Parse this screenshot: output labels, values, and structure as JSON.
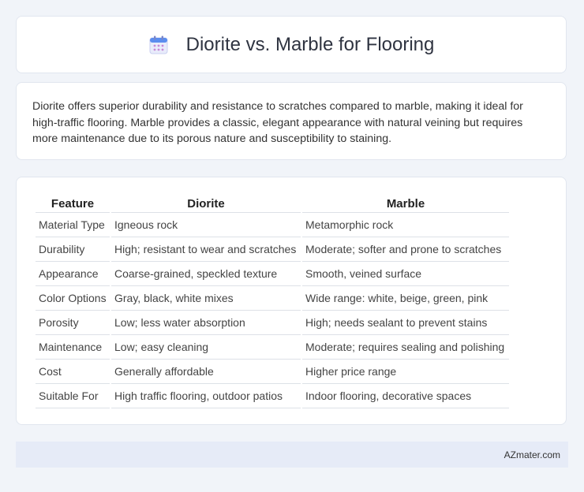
{
  "header": {
    "title": "Diorite vs. Marble for Flooring",
    "icon": "calendar-icon"
  },
  "description": "Diorite offers superior durability and resistance to scratches compared to marble, making it ideal for high-traffic flooring. Marble provides a classic, elegant appearance with natural veining but requires more maintenance due to its porous nature and susceptibility to staining.",
  "table": {
    "headers": [
      "Feature",
      "Diorite",
      "Marble"
    ],
    "rows": [
      [
        "Material Type",
        "Igneous rock",
        "Metamorphic rock"
      ],
      [
        "Durability",
        "High; resistant to wear and scratches",
        "Moderate; softer and prone to scratches"
      ],
      [
        "Appearance",
        "Coarse-grained, speckled texture",
        "Smooth, veined surface"
      ],
      [
        "Color Options",
        "Gray, black, white mixes",
        "Wide range: white, beige, green, pink"
      ],
      [
        "Porosity",
        "Low; less water absorption",
        "High; needs sealant to prevent stains"
      ],
      [
        "Maintenance",
        "Low; easy cleaning",
        "Moderate; requires sealing and polishing"
      ],
      [
        "Cost",
        "Generally affordable",
        "Higher price range"
      ],
      [
        "Suitable For",
        "High traffic flooring, outdoor patios",
        "Indoor flooring, decorative spaces"
      ]
    ]
  },
  "footer": {
    "brand": "AZmater.com"
  }
}
